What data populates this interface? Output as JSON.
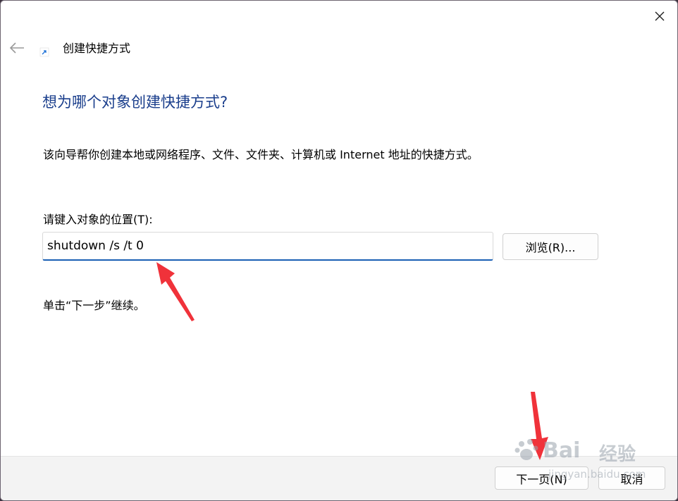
{
  "window": {
    "title": "创建快捷方式",
    "close_icon": "close-icon",
    "back_icon": "back-arrow-icon",
    "shortcut_icon": "shortcut-arrow-icon"
  },
  "main": {
    "heading": "想为哪个对象创建快捷方式?",
    "description": "该向导帮你创建本地或网络程序、文件、文件夹、计算机或 Internet 地址的快捷方式。",
    "location_label": "请键入对象的位置(T):",
    "location_value": "shutdown /s /t 0",
    "browse_label": "浏览(R)...",
    "continue_text": "单击“下一步”继续。"
  },
  "footer": {
    "next_label": "下一页(N)",
    "cancel_label": "取消"
  },
  "colors": {
    "heading": "#1a3e8c",
    "accent": "#1a5fb4",
    "annotation_arrow": "#f0323a",
    "footer_bg": "#f3f3f3"
  },
  "watermark": {
    "brand": "Bai",
    "brand_cn": "经验",
    "url": "jingyan.baidu.com"
  }
}
